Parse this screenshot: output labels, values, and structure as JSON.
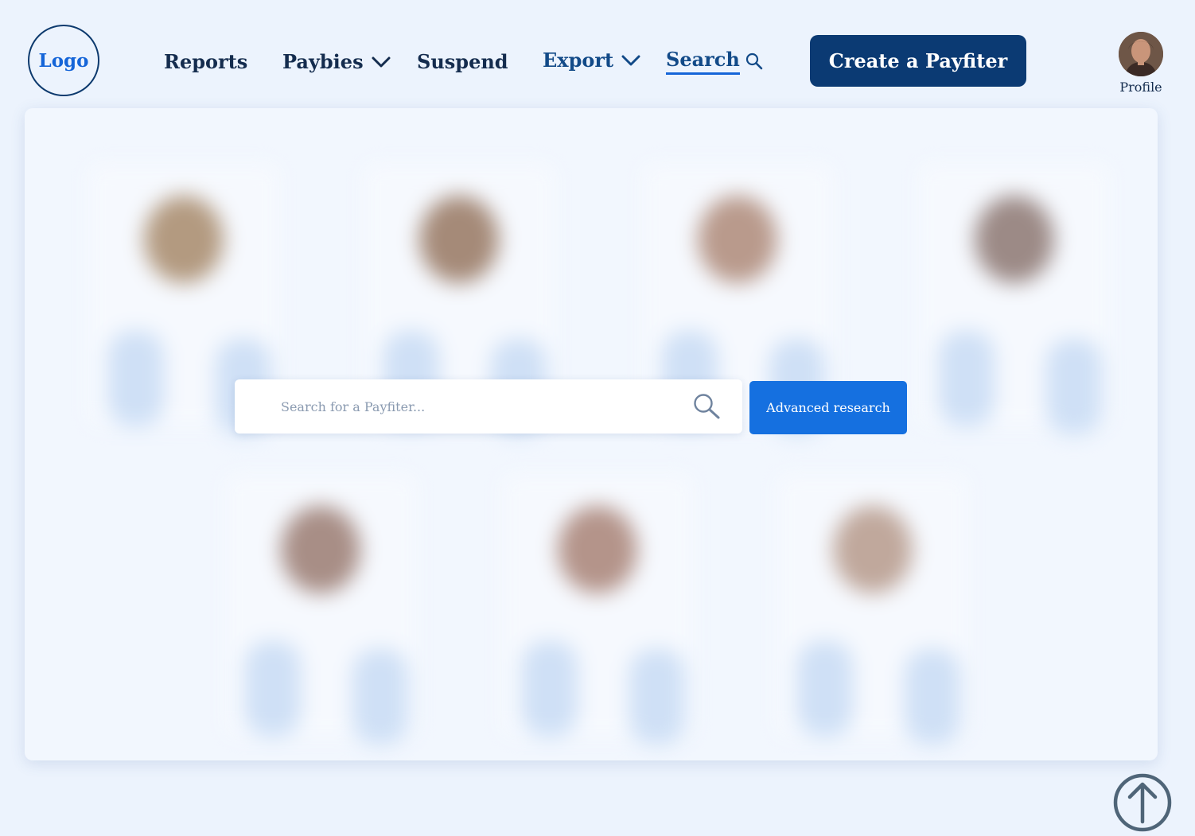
{
  "header": {
    "logo_label": "Logo",
    "nav": {
      "reports": "Reports",
      "paybies": "Paybies",
      "suspend": "Suspend",
      "export": "Export",
      "search": "Search"
    },
    "create_button_label": "Create a Payfiter",
    "profile_label": "Profile"
  },
  "search": {
    "placeholder": "Search for a Payfiter...",
    "value": "",
    "advanced_label": "Advanced research"
  },
  "icons": {
    "paybies_dropdown": "chevron-down-icon",
    "export_dropdown": "chevron-down-icon",
    "nav_search": "search-icon",
    "search_field": "search-icon",
    "back_to_top": "arrow-up-circle-icon"
  },
  "colors": {
    "background": "#ecf3fd",
    "primary_dark": "#0b3a73",
    "accent_blue": "#1570e0",
    "nav_text": "#142c4e"
  }
}
